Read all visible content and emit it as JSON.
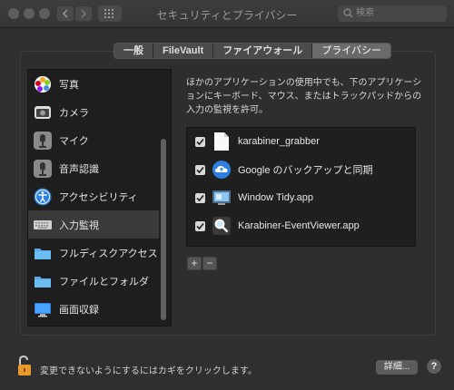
{
  "window": {
    "title": "セキュリティとプライバシー"
  },
  "search": {
    "placeholder": "検索"
  },
  "tabs": [
    {
      "label": "一般"
    },
    {
      "label": "FileVault"
    },
    {
      "label": "ファイアウォール"
    },
    {
      "label": "プライバシー",
      "active": true
    }
  ],
  "sidebar": {
    "items": [
      {
        "label": "写真",
        "icon": "photos-icon"
      },
      {
        "label": "カメラ",
        "icon": "camera-icon"
      },
      {
        "label": "マイク",
        "icon": "microphone-icon"
      },
      {
        "label": "音声認識",
        "icon": "speech-recognition-icon"
      },
      {
        "label": "アクセシビリティ",
        "icon": "accessibility-icon"
      },
      {
        "label": "入力監視",
        "icon": "keyboard-icon",
        "selected": true
      },
      {
        "label": "フルディスクアクセス",
        "icon": "folder-icon"
      },
      {
        "label": "ファイルとフォルダ",
        "icon": "folder-icon"
      },
      {
        "label": "画面収録",
        "icon": "display-icon"
      }
    ]
  },
  "main": {
    "description": "ほかのアプリケーションの使用中でも、下のアプリケーションにキーボード、マウス、またはトラックパッドからの入力の監視を許可。",
    "apps": [
      {
        "name": "karabiner_grabber",
        "checked": true,
        "icon": "document-icon"
      },
      {
        "name": "Google のバックアップと同期",
        "checked": true,
        "icon": "cloud-upload-icon"
      },
      {
        "name": "Window Tidy.app",
        "checked": true,
        "icon": "window-tidy-icon"
      },
      {
        "name": "Karabiner-EventViewer.app",
        "checked": true,
        "icon": "magnifier-icon"
      }
    ],
    "add_label": "+",
    "remove_label": "−"
  },
  "footer": {
    "lock_text": "変更できないようにするにはカギをクリックします。",
    "advanced_label": "詳細...",
    "help_label": "?"
  },
  "colors": {
    "accent_blue": "#2f7fe0",
    "lock_orange": "#e89a2a"
  }
}
